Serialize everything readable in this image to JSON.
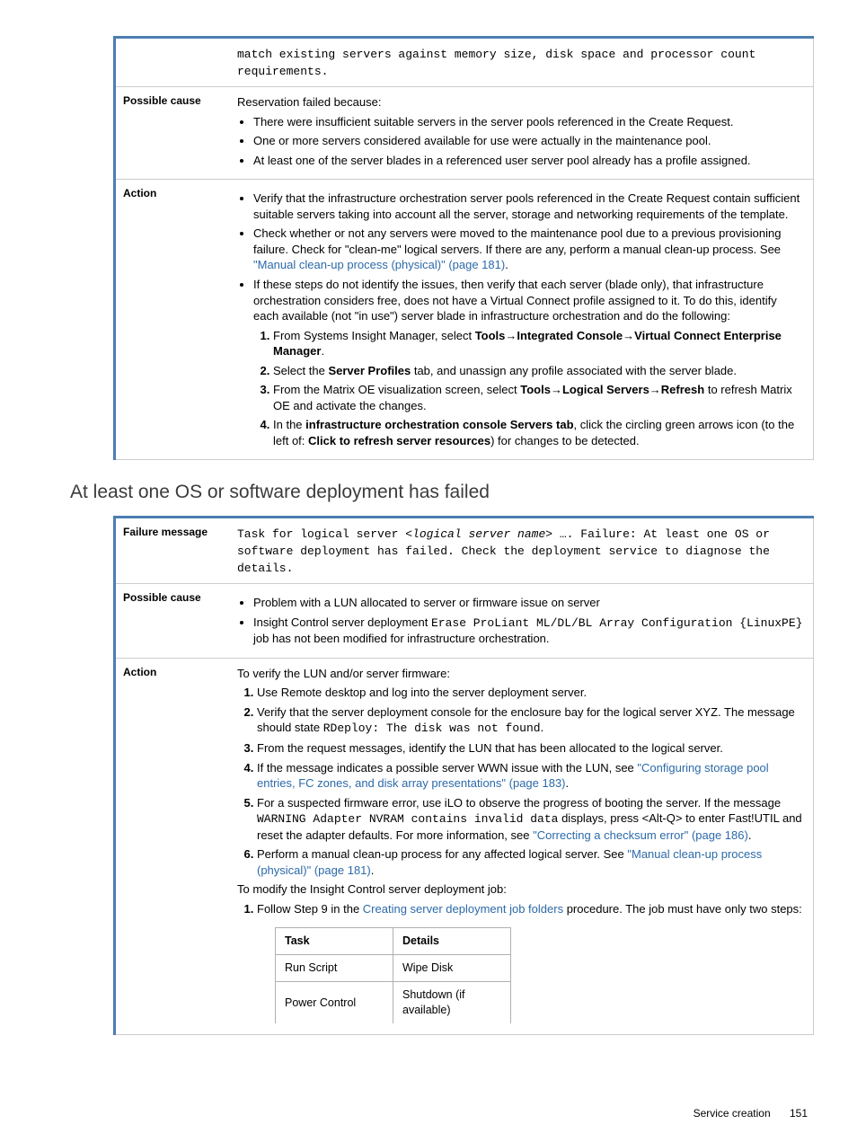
{
  "table1": {
    "row0": {
      "desc_part": "match existing servers against memory size, disk space and processor count requirements."
    },
    "row1": {
      "label": "Possible cause",
      "intro": "Reservation failed because:",
      "b1": "There were insufficient suitable servers in the server pools referenced in the Create Request.",
      "b2": "One or more servers considered available for use were actually in the maintenance pool.",
      "b3": "At least one of the server blades in a referenced user server pool already has a profile assigned."
    },
    "row2": {
      "label": "Action",
      "b1": "Verify that the infrastructure orchestration server pools referenced in the Create Request contain sufficient suitable servers taking into account all the server, storage and networking requirements of the template.",
      "b2_pre": "Check whether or not any servers were moved to the maintenance pool due to a previous provisioning failure. Check for \"clean-me\" logical servers. If there are any, perform a manual clean-up process. See ",
      "b2_link": "\"Manual clean-up process (physical)\" (page 181)",
      "b2_post": ".",
      "b3": "If these steps do not identify the issues, then verify that each server (blade only), that infrastructure orchestration considers free, does not have a Virtual Connect profile assigned to it. To do this, identify each available (not \"in use\") server blade in infrastructure orchestration and do the following:",
      "n1_pre": "From Systems Insight Manager, select ",
      "n1_b1": "Tools",
      "n1_arrow": "→",
      "n1_b2": "Integrated Console",
      "n1_b3": "Virtual Connect Enterprise Manager",
      "n1_post": ".",
      "n2_pre": "Select the ",
      "n2_b": "Server Profiles",
      "n2_post": " tab, and unassign any profile associated with the server blade.",
      "n3_pre": "From the Matrix OE visualization screen, select ",
      "n3_b1": "Tools",
      "n3_b2": "Logical Servers",
      "n3_b3": "Refresh",
      "n3_post": " to refresh Matrix OE and activate the changes.",
      "n4_pre": "In the ",
      "n4_b": "infrastructure orchestration console Servers tab",
      "n4_mid": ", click the circling green arrows icon (to the left of: ",
      "n4_b2": "Click to refresh server resources",
      "n4_post": ") for changes to be detected."
    }
  },
  "heading": "At least one OS or software deployment has failed",
  "table2": {
    "row1": {
      "label": "Failure message",
      "m_pre": "Task for logical server ",
      "m_it": "<logical server name>",
      "m_post": " …. Failure: At least one OS or software deployment has failed. Check the deployment service to diagnose the details."
    },
    "row2": {
      "label": "Possible cause",
      "b1": "Problem with a LUN allocated to server or firmware issue on server",
      "b2_pre": "Insight Control server deployment ",
      "b2_code": "Erase ProLiant ML/DL/BL Array Configuration {LinuxPE}",
      "b2_post": " job has not been modified for infrastructure orchestration."
    },
    "row3": {
      "label": "Action",
      "intro1": "To verify the LUN and/or server firmware:",
      "n1": "Use Remote desktop and log into the server deployment server.",
      "n2_pre": "Verify that the server deployment console for the enclosure bay for the logical server XYZ. The message should state ",
      "n2_code": "RDeploy: The disk was not found",
      "n2_post": ".",
      "n3": "From the request messages, identify the LUN that has been allocated to the logical server.",
      "n4_pre": "If the message indicates a possible server WWN issue with the LUN, see ",
      "n4_link": "\"Configuring storage pool entries, FC zones, and disk array presentations\" (page 183)",
      "n4_post": ".",
      "n5_pre": "For a suspected firmware error, use iLO to observe the progress of booting the server. If the message ",
      "n5_code": "WARNING Adapter NVRAM contains invalid data",
      "n5_mid": " displays, press <Alt-Q> to enter Fast!UTIL and reset the adapter defaults. For more information, see ",
      "n5_link": "\"Correcting a checksum error\" (page 186)",
      "n5_post": ".",
      "n6_pre": "Perform a manual clean-up process for any affected logical server. See ",
      "n6_link": "\"Manual clean-up process (physical)\" (page 181)",
      "n6_post": ".",
      "intro2": "To modify the Insight Control server deployment job:",
      "m1_pre": "Follow Step 9 in the ",
      "m1_link": "Creating server deployment job folders",
      "m1_post": " procedure. The job must have only two steps:",
      "tbl_h1": "Task",
      "tbl_h2": "Details",
      "tbl_r1c1": "Run Script",
      "tbl_r1c2": "Wipe Disk",
      "tbl_r2c1": "Power Control",
      "tbl_r2c2": "Shutdown (if available)"
    }
  },
  "footer_section": "Service creation",
  "footer_page": "151"
}
